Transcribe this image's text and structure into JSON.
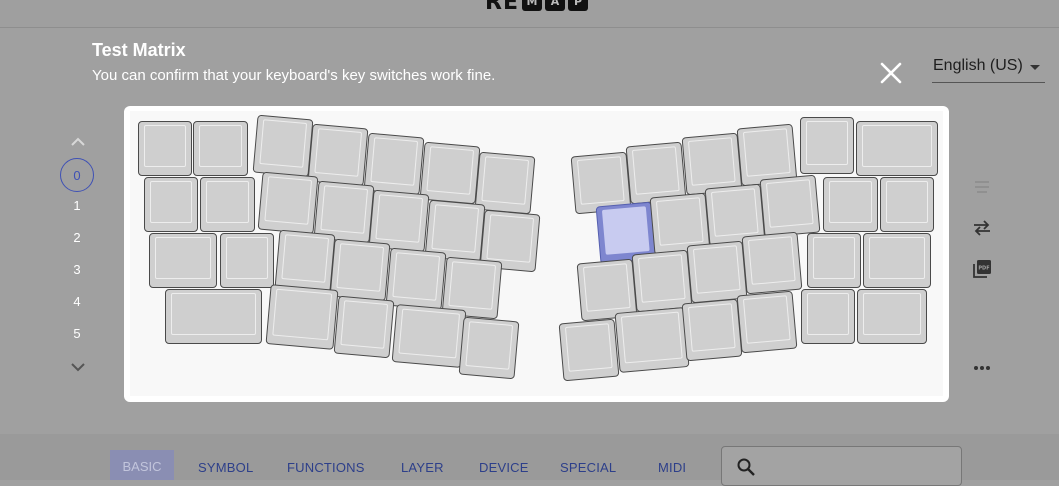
{
  "app": {
    "logo_prefix": "RE",
    "logo_boxes": [
      "M",
      "A",
      "P"
    ]
  },
  "dialog": {
    "title": "Test Matrix",
    "subtitle": "You can confirm that your keyboard's key switches work fine."
  },
  "language": {
    "selected": "English (US)"
  },
  "layers": {
    "items": [
      "0",
      "1",
      "2",
      "3",
      "4",
      "5"
    ],
    "selected_index": 0
  },
  "keyboard": {
    "pressed_key": "right-r2c1"
  },
  "tools": [
    "hamburger-icon",
    "swap-icon",
    "pdf-icon",
    "more-icon"
  ],
  "categories": {
    "items": [
      "BASIC",
      "SYMBOL",
      "FUNCTIONS",
      "LAYER",
      "DEVICE",
      "SPECIAL",
      "MIDI"
    ],
    "selected": "BASIC"
  },
  "search": {
    "placeholder": ""
  },
  "colors": {
    "accent": "#3f51b5",
    "pressed_key": "#7e86cf"
  }
}
